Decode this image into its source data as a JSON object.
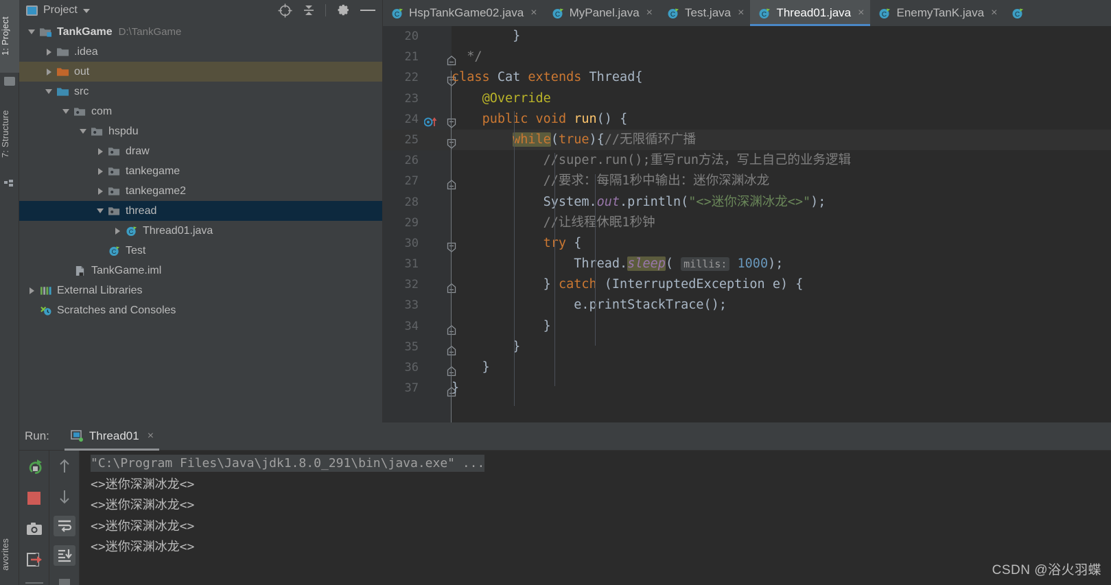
{
  "window": {
    "left_tool_tabs": [
      {
        "label": "1: Project",
        "icon": "folder-icon",
        "active": true
      },
      {
        "label": "7: Structure",
        "icon": "structure-icon",
        "active": false
      },
      {
        "label": "avorites",
        "icon": "star-icon",
        "active": false
      }
    ]
  },
  "project_panel": {
    "title": "Project",
    "title_icon": "project-view-icon",
    "actions": [
      {
        "name": "locate-icon",
        "tooltip": "Select Opened File"
      },
      {
        "name": "collapse-all-icon",
        "tooltip": "Collapse All"
      },
      {
        "name": "gear-icon",
        "tooltip": "Settings"
      },
      {
        "name": "minimize-icon",
        "tooltip": "Hide"
      }
    ],
    "tree": [
      {
        "label": "TankGame",
        "path": "D:\\TankGame",
        "indent": 0,
        "twisty": "open",
        "icon": "module-icon",
        "bold": true,
        "selected": "none"
      },
      {
        "label": ".idea",
        "path": "",
        "indent": 1,
        "twisty": "closed",
        "icon": "folder-gray-icon",
        "bold": false,
        "selected": "none"
      },
      {
        "label": "out",
        "path": "",
        "indent": 1,
        "twisty": "closed",
        "icon": "folder-orange-icon",
        "bold": false,
        "selected": "olive"
      },
      {
        "label": "src",
        "path": "",
        "indent": 1,
        "twisty": "open",
        "icon": "folder-blue-icon",
        "bold": false,
        "selected": "none"
      },
      {
        "label": "com",
        "path": "",
        "indent": 2,
        "twisty": "open",
        "icon": "package-icon",
        "bold": false,
        "selected": "none"
      },
      {
        "label": "hspdu",
        "path": "",
        "indent": 3,
        "twisty": "open",
        "icon": "package-icon",
        "bold": false,
        "selected": "none"
      },
      {
        "label": "draw",
        "path": "",
        "indent": 4,
        "twisty": "closed",
        "icon": "package-icon",
        "bold": false,
        "selected": "none"
      },
      {
        "label": "tankegame",
        "path": "",
        "indent": 4,
        "twisty": "closed",
        "icon": "package-icon",
        "bold": false,
        "selected": "none"
      },
      {
        "label": "tankegame2",
        "path": "",
        "indent": 4,
        "twisty": "closed",
        "icon": "package-icon",
        "bold": false,
        "selected": "none"
      },
      {
        "label": "thread",
        "path": "",
        "indent": 4,
        "twisty": "open",
        "icon": "package-icon",
        "bold": false,
        "selected": "blue"
      },
      {
        "label": "Thread01.java",
        "path": "",
        "indent": 5,
        "twisty": "closed",
        "icon": "java-class-icon",
        "bold": false,
        "selected": "none"
      },
      {
        "label": "Test",
        "path": "",
        "indent": 4,
        "twisty": "none",
        "icon": "java-class-icon",
        "bold": false,
        "selected": "none"
      },
      {
        "label": "TankGame.iml",
        "path": "",
        "indent": 2,
        "twisty": "none",
        "icon": "iml-file-icon",
        "bold": false,
        "selected": "none"
      },
      {
        "label": "External Libraries",
        "path": "",
        "indent": 0,
        "twisty": "closed",
        "icon": "libraries-icon",
        "bold": false,
        "selected": "none"
      },
      {
        "label": "Scratches and Consoles",
        "path": "",
        "indent": 0,
        "twisty": "none",
        "icon": "scratches-icon",
        "bold": false,
        "selected": "none"
      }
    ]
  },
  "editor_tabs": [
    {
      "label": "HspTankGame02.java",
      "icon": "java-class-icon",
      "active": false,
      "close": "×"
    },
    {
      "label": "MyPanel.java",
      "icon": "java-class-icon",
      "active": false,
      "close": "×"
    },
    {
      "label": "Test.java",
      "icon": "java-class-icon",
      "active": false,
      "close": "×"
    },
    {
      "label": "Thread01.java",
      "icon": "java-class-icon",
      "active": true,
      "close": "×"
    },
    {
      "label": "EnemyTanK.java",
      "icon": "java-class-icon",
      "active": false,
      "close": "×"
    }
  ],
  "editor": {
    "first_line": 20,
    "current_line": 25,
    "lines": [
      {
        "n": "20",
        "indent_cols": 2
      },
      {
        "n": "21",
        "indent_cols": 0
      },
      {
        "n": "22",
        "indent_cols": 0
      },
      {
        "n": "23",
        "indent_cols": 1
      },
      {
        "n": "24",
        "indent_cols": 1
      },
      {
        "n": "25",
        "indent_cols": 2
      },
      {
        "n": "26",
        "indent_cols": 3
      },
      {
        "n": "27",
        "indent_cols": 3
      },
      {
        "n": "28",
        "indent_cols": 3
      },
      {
        "n": "29",
        "indent_cols": 3
      },
      {
        "n": "30",
        "indent_cols": 3
      },
      {
        "n": "31",
        "indent_cols": 4
      },
      {
        "n": "32",
        "indent_cols": 3
      },
      {
        "n": "33",
        "indent_cols": 4
      },
      {
        "n": "34",
        "indent_cols": 3
      },
      {
        "n": "35",
        "indent_cols": 2
      },
      {
        "n": "36",
        "indent_cols": 1
      },
      {
        "n": "37",
        "indent_cols": 0
      }
    ],
    "code_text": {
      "l20": "        }",
      "l21": "  */",
      "l22": "class Cat extends Thread{",
      "l23": "    @Override",
      "l24": "    public void run() {",
      "l25": "        while(true){//无限循环广播",
      "l26": "            //super.run();重写run方法，写上自己的业务逻辑",
      "l27": "            //要求：每隔1秒中输出：迷你深渊冰龙",
      "l28": "            System.out.println(\"<>迷你深渊冰龙<>\");",
      "l29": "            //让线程休眠1秒钟",
      "l30": "            try {",
      "l31": "                Thread.sleep( millis: 1000);",
      "l32": "            } catch (InterruptedException e) {",
      "l33": "                e.printStackTrace();",
      "l34": "            }",
      "l35": "        }",
      "l36": "    }",
      "l37": "}"
    },
    "gutter_marker_line": "24",
    "gutter_marker_icon": "override-method-icon",
    "param_hint": "millis:"
  },
  "run_panel": {
    "label": "Run:",
    "tab": {
      "label": "Thread01",
      "icon": "run-config-icon",
      "close": "×"
    },
    "toolbar_left": [
      {
        "name": "rerun-icon"
      },
      {
        "name": "stop-icon"
      },
      {
        "name": "screenshot-icon"
      },
      {
        "name": "export-icon"
      }
    ],
    "toolbar_right": [
      {
        "name": "up-arrow-icon",
        "pressed": false
      },
      {
        "name": "down-arrow-icon",
        "pressed": false
      },
      {
        "name": "soft-wrap-icon",
        "pressed": true
      },
      {
        "name": "scroll-to-end-icon",
        "pressed": true
      }
    ],
    "console_lines": [
      {
        "text": "\"C:\\Program Files\\Java\\jdk1.8.0_291\\bin\\java.exe\" ...",
        "kind": "cmd"
      },
      {
        "text": "<>迷你深渊冰龙<>",
        "kind": "out"
      },
      {
        "text": "<>迷你深渊冰龙<>",
        "kind": "out"
      },
      {
        "text": "<>迷你深渊冰龙<>",
        "kind": "out"
      },
      {
        "text": "<>迷你深渊冰龙<>",
        "kind": "out"
      }
    ]
  },
  "watermark": "CSDN @浴火羽蝶",
  "colors": {
    "bg_panel": "#3c3f41",
    "bg_editor": "#2b2b2b",
    "bg_gutter": "#313335",
    "accent_tab": "#4a88c7",
    "sel_blue": "#0d293e",
    "sel_olive": "#55503c",
    "keyword": "#cc7832",
    "string": "#6a8759",
    "number": "#6897bb",
    "comment": "#808080",
    "annotation": "#bbb529",
    "static_field": "#9876aa",
    "text": "#a9b7c6"
  }
}
